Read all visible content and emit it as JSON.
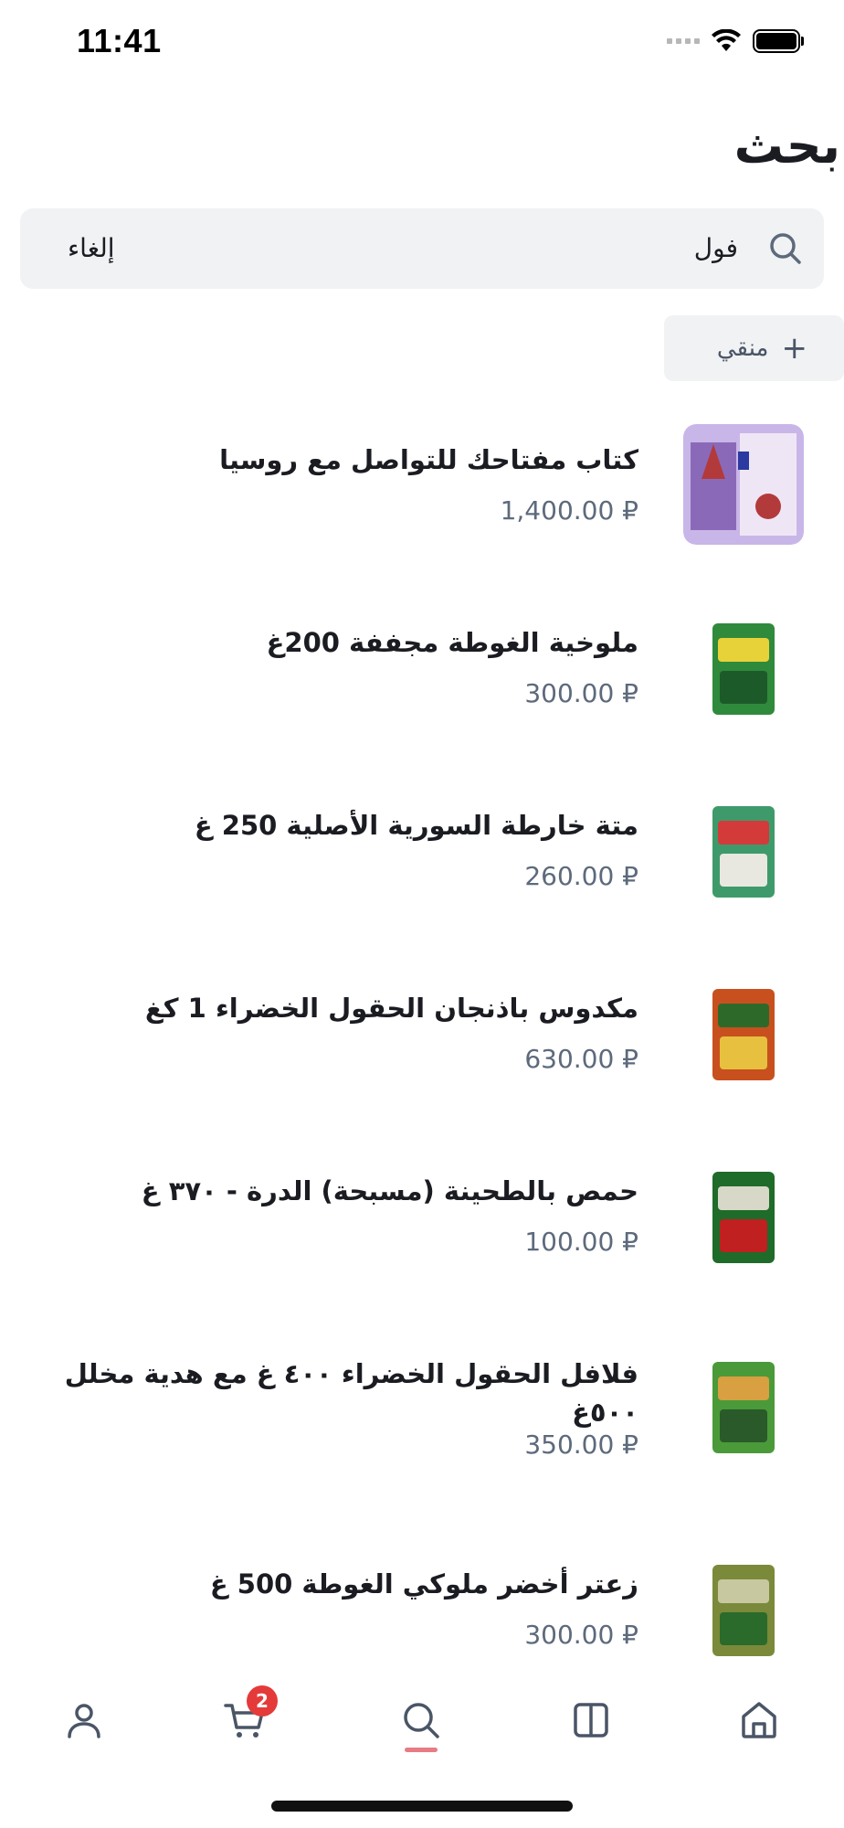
{
  "status_bar": {
    "time": "11:41"
  },
  "header": {
    "title": "بحث"
  },
  "search": {
    "value": "فول",
    "cancel_label": "إلغاء"
  },
  "filter": {
    "label": "منقي",
    "icon": "plus-icon"
  },
  "products": [
    {
      "name": "كتاب مفتاحك للتواصل مع روسيا",
      "price": "1,400.00 ₽",
      "thumb_colors": [
        "#c9b6e8",
        "#b33a3a",
        "#f0e2b8"
      ]
    },
    {
      "name": "ملوخية الغوطة مجففة 200غ",
      "price": "300.00 ₽",
      "thumb_colors": [
        "#2f8a3b",
        "#e8d23a",
        "#1d5a2a"
      ]
    },
    {
      "name": "متة خارطة السورية الأصلية 250 غ",
      "price": "260.00 ₽",
      "thumb_colors": [
        "#3f9a6b",
        "#d33a3a",
        "#e8e8e0"
      ]
    },
    {
      "name": "مكدوس باذنجان الحقول الخضراء 1 كغ",
      "price": "630.00 ₽",
      "thumb_colors": [
        "#c8501e",
        "#2d6a2a",
        "#e8c040"
      ]
    },
    {
      "name": "حمص بالطحينة (مسبحة) الدرة - ٣٧٠ غ",
      "price": "100.00 ₽",
      "thumb_colors": [
        "#1f6b2a",
        "#d8d8c8",
        "#c02020"
      ]
    },
    {
      "name": "فلافل الحقول الخضراء ٤٠٠ غ مع هدية مخلل ٥٠٠غ",
      "price": "350.00 ₽",
      "thumb_colors": [
        "#4a9a3a",
        "#d8a040",
        "#2a5a2a"
      ]
    },
    {
      "name": "زعتر أخضر ملوكي الغوطة 500 غ",
      "price": "300.00 ₽",
      "thumb_colors": [
        "#7a8a3a",
        "#c8c8a0",
        "#2a6a2a"
      ]
    }
  ],
  "tab_bar": {
    "items": [
      {
        "name": "profile",
        "icon": "user-icon"
      },
      {
        "name": "cart",
        "icon": "cart-icon",
        "badge": "2"
      },
      {
        "name": "search",
        "icon": "search-icon",
        "active": true
      },
      {
        "name": "catalog",
        "icon": "book-icon"
      },
      {
        "name": "home",
        "icon": "home-icon"
      }
    ]
  },
  "colors": {
    "accent": "#e87b84",
    "badge": "#e53a3a",
    "text_primary": "#1a1c22",
    "text_secondary": "#5d6a7c",
    "search_bg": "#f1f2f4"
  }
}
